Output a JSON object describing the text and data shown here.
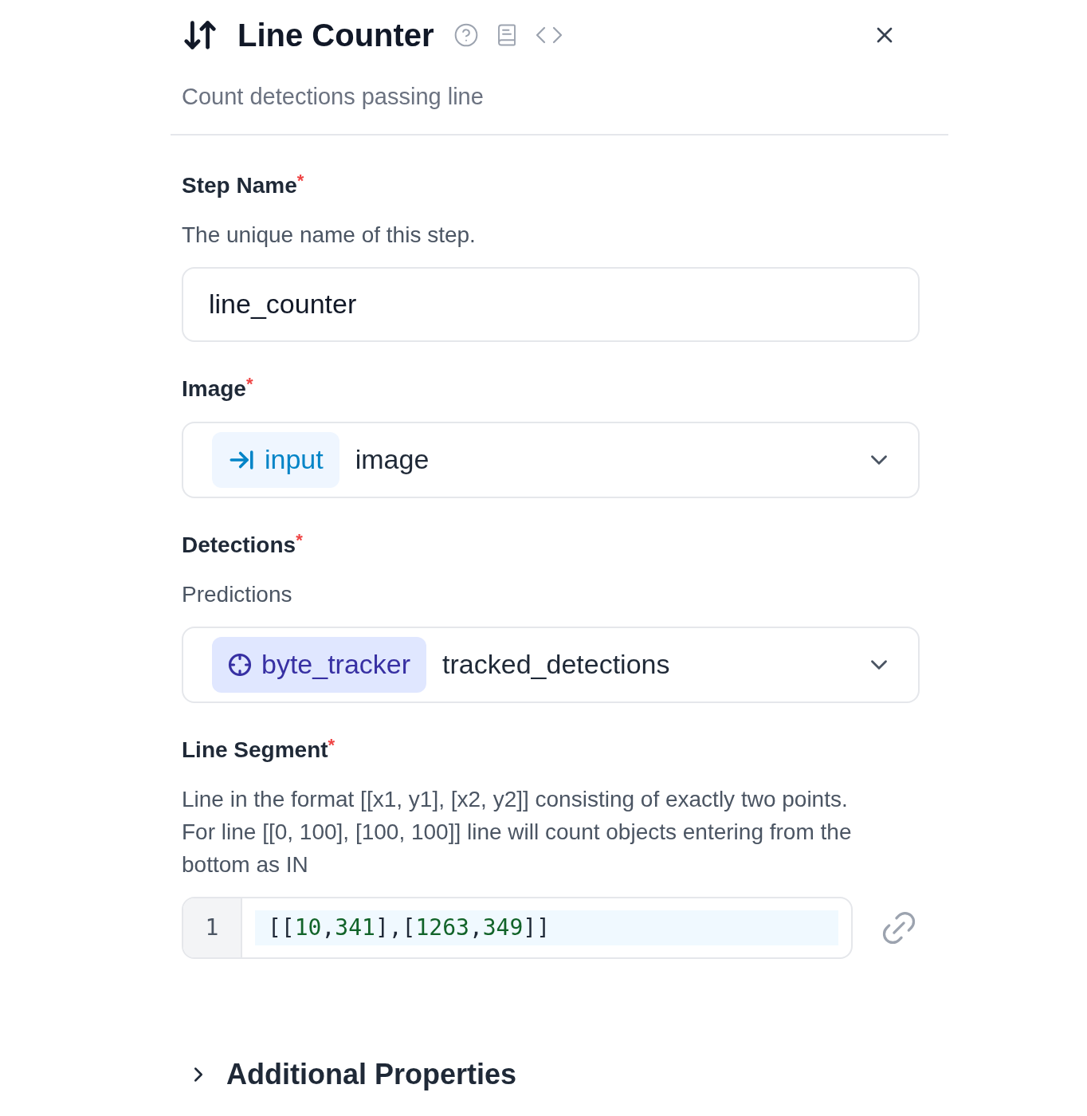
{
  "header": {
    "title": "Line Counter",
    "subtitle": "Count detections passing line"
  },
  "fields": [
    {
      "kind": "text",
      "label": "Step Name",
      "required_mark": "*",
      "description": "The unique name of this step.",
      "value": "line_counter"
    },
    {
      "kind": "select",
      "label": "Image",
      "required_mark": "*",
      "chip": {
        "kind": "input",
        "label": "input"
      },
      "value": "image"
    },
    {
      "kind": "select",
      "label": "Detections",
      "required_mark": "*",
      "description": "Predictions",
      "chip": {
        "kind": "step",
        "label": "byte_tracker"
      },
      "value": "tracked_detections"
    },
    {
      "kind": "code",
      "label": "Line Segment",
      "required_mark": "*",
      "description": "Line in the format [[x1, y1], [x2, y2]] consisting of exactly two points. For line [[0, 100], [100, 100]] line will count objects entering from the bottom as IN",
      "line_number": "1",
      "code": "[[10,341],[1263,349]]"
    }
  ],
  "additional": {
    "label": "Additional Properties",
    "expanded": false
  }
}
